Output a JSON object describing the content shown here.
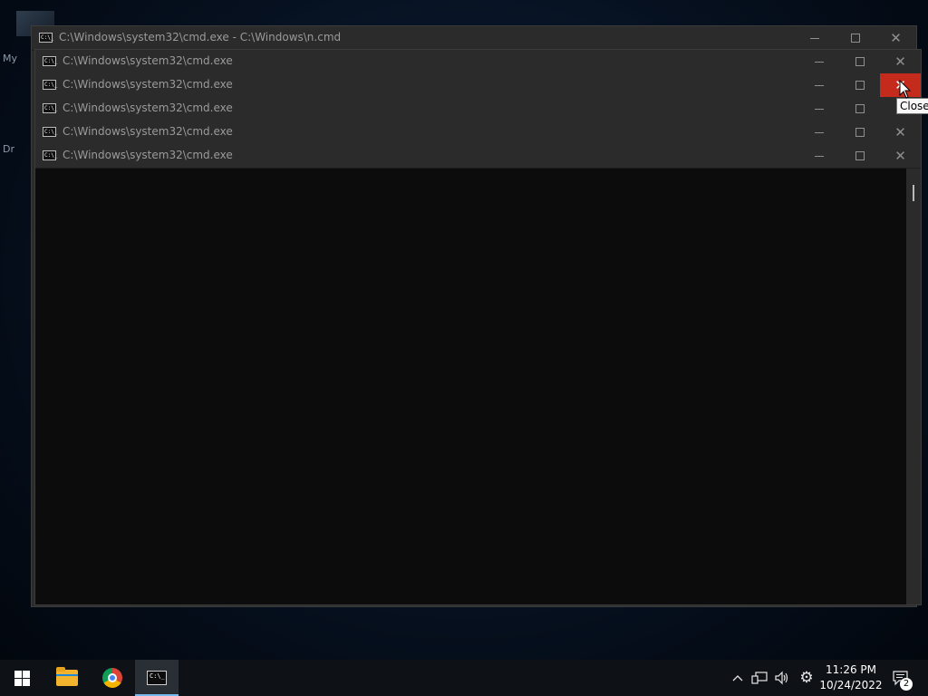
{
  "desktop": {
    "label_top": "My",
    "label_bottom": "Dr"
  },
  "windows": [
    {
      "title": "C:\\Windows\\system32\\cmd.exe - C:\\Windows\\n.cmd"
    },
    {
      "title": "C:\\Windows\\system32\\cmd.exe"
    },
    {
      "title": "C:\\Windows\\system32\\cmd.exe"
    },
    {
      "title": "C:\\Windows\\system32\\cmd.exe"
    },
    {
      "title": "C:\\Windows\\system32\\cmd.exe"
    },
    {
      "title": "C:\\Windows\\system32\\cmd.exe"
    }
  ],
  "window_controls": {
    "minimize": "—",
    "close": "✕"
  },
  "tooltip": {
    "text": "Close"
  },
  "icons": {
    "cmd": "C:\\_",
    "start": "windows-logo-icon",
    "file_explorer": "folder-icon",
    "chrome": "chrome-icon",
    "chevron": "^",
    "network": "network-icon",
    "volume": "speaker-icon",
    "settings": "⚙",
    "notifications": "notification-icon"
  },
  "taskbar": {
    "time": "11:26 PM",
    "date": "10/24/2022",
    "notification_count": "2"
  },
  "colors": {
    "close_hover": "#c42b1c",
    "taskbar_active_underline": "#76b9ed"
  }
}
